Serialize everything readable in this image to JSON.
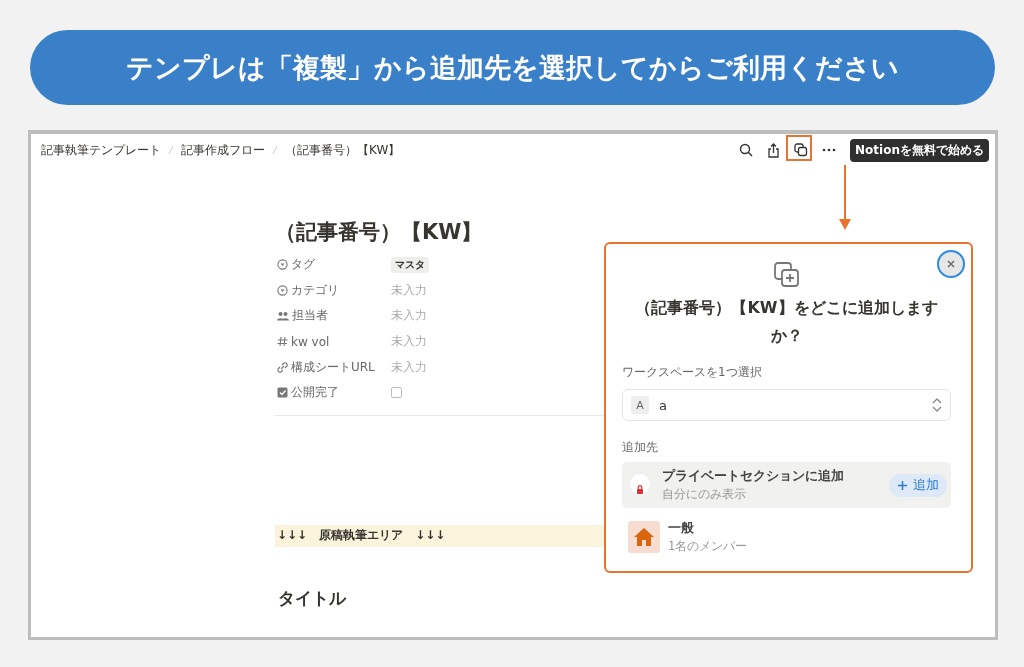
{
  "banner": {
    "text": "テンプレは「複製」から追加先を選択してからご利用ください"
  },
  "breadcrumbs": [
    "記事執筆テンプレート",
    "記事作成フロー",
    "（記事番号）【KW】"
  ],
  "toolbar": {
    "cta": "Notionを無料で始める"
  },
  "page": {
    "title": "（記事番号）【KW】",
    "properties": [
      {
        "kind": "tag",
        "label": "タグ",
        "value": "マスタ"
      },
      {
        "kind": "text",
        "label": "カテゴリ",
        "placeholder": "未入力"
      },
      {
        "kind": "text",
        "label": "担当者",
        "placeholder": "未入力"
      },
      {
        "kind": "text",
        "label": "kw vol",
        "placeholder": "未入力"
      },
      {
        "kind": "text",
        "label": "構成シートURL",
        "placeholder": "未入力"
      },
      {
        "kind": "checkbox",
        "label": "公開完了",
        "checked": false
      }
    ],
    "callout": "↓↓↓　原稿執筆エリア　↓↓↓",
    "heading": "タイトル"
  },
  "dialog": {
    "title": "（記事番号）【KW】をどこに追加しますか？",
    "workspace_label": "ワークスペースを1つ選択",
    "workspace": {
      "initial": "A",
      "name": "a"
    },
    "destination_label": "追加先",
    "destinations": [
      {
        "kind": "private",
        "title": "プライベートセクションに追加",
        "subtitle": "自分にのみ表示",
        "selected": true,
        "action": "追加"
      },
      {
        "kind": "team",
        "title": "一般",
        "subtitle": "1名のメンバー",
        "selected": false
      }
    ]
  }
}
